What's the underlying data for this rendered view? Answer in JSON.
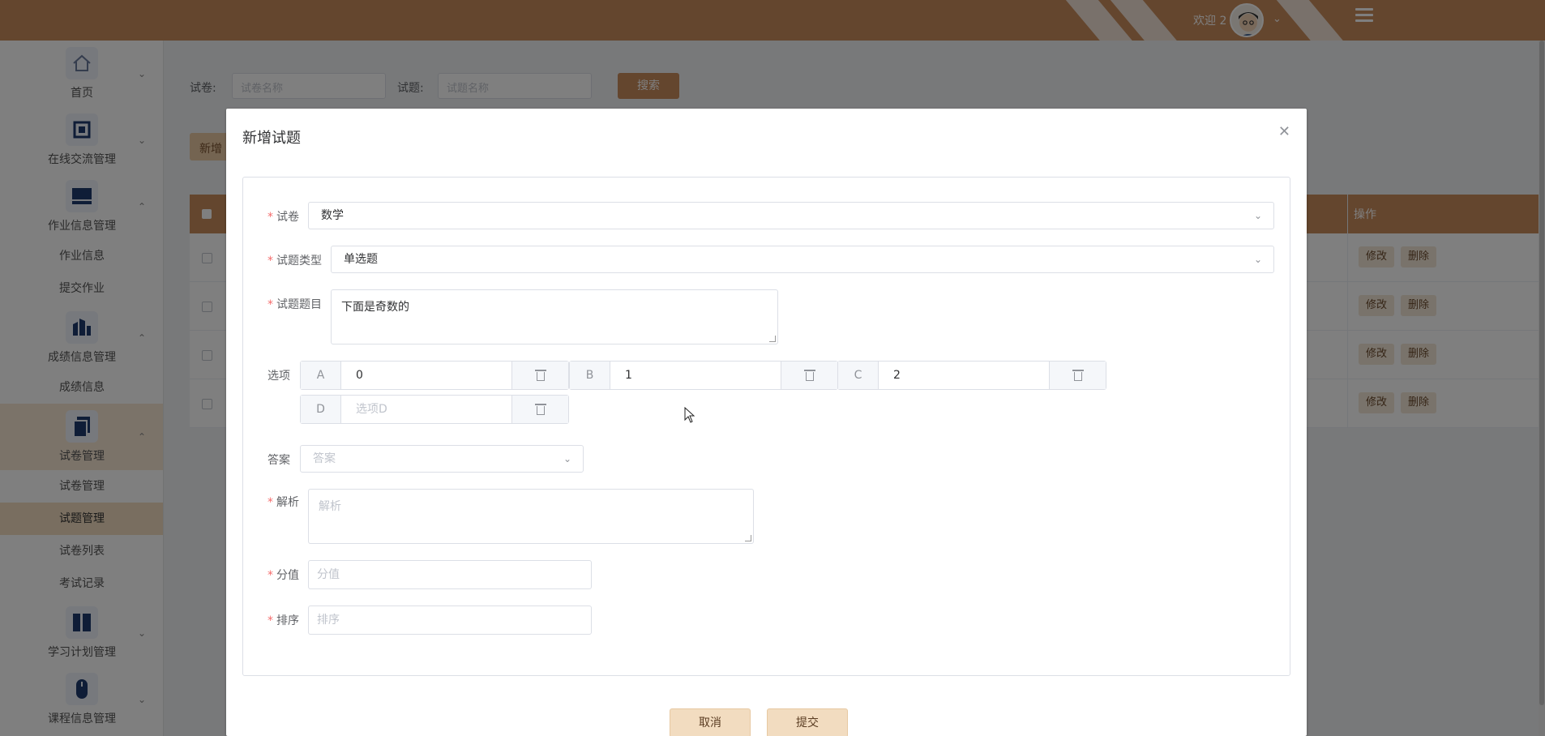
{
  "topbar": {
    "welcome": "欢迎 2"
  },
  "sidebar": {
    "groups": [
      {
        "label": "首页",
        "icon": "home-icon"
      },
      {
        "label": "在线交流管理",
        "icon": "chip-icon"
      },
      {
        "label": "作业信息管理",
        "icon": "monitor-icon",
        "children": [
          "作业信息",
          "提交作业"
        ]
      },
      {
        "label": "成绩信息管理",
        "icon": "building-icon",
        "children": [
          "成绩信息"
        ]
      },
      {
        "label": "试卷管理",
        "icon": "copy-icon",
        "children": [
          "试卷管理",
          "试题管理",
          "试卷列表",
          "考试记录"
        ]
      },
      {
        "label": "学习计划管理",
        "icon": "columns-icon"
      },
      {
        "label": "课程信息管理",
        "icon": "mouse-icon"
      }
    ]
  },
  "search": {
    "paper_label": "试卷:",
    "paper_placeholder": "试卷名称",
    "question_label": "试题:",
    "question_placeholder": "试题名称",
    "search_button": "搜索"
  },
  "toolbar": {
    "add_button": "新增"
  },
  "table": {
    "op_header": "操作",
    "edit_label": "修改",
    "delete_label": "删除"
  },
  "dialog": {
    "title": "新增试题",
    "fields": {
      "paper": {
        "label": "试卷",
        "value": "数学"
      },
      "type": {
        "label": "试题类型",
        "value": "单选题"
      },
      "question": {
        "label": "试题题目",
        "value": "下面是奇数的"
      },
      "options_label": "选项",
      "answer": {
        "label": "答案",
        "placeholder": "答案"
      },
      "analysis": {
        "label": "解析",
        "placeholder": "解析"
      },
      "score": {
        "label": "分值",
        "placeholder": "分值"
      },
      "sort": {
        "label": "排序",
        "placeholder": "排序"
      }
    },
    "options": [
      {
        "key": "A",
        "value": "0"
      },
      {
        "key": "B",
        "value": "1"
      },
      {
        "key": "C",
        "value": "2"
      },
      {
        "key": "D",
        "value": "",
        "placeholder": "选项D"
      }
    ],
    "cancel_button": "取消",
    "submit_button": "提交"
  },
  "colors": {
    "accent": "#c98c5c",
    "accent_light": "#f2dcc0",
    "required": "#f56c6c"
  }
}
